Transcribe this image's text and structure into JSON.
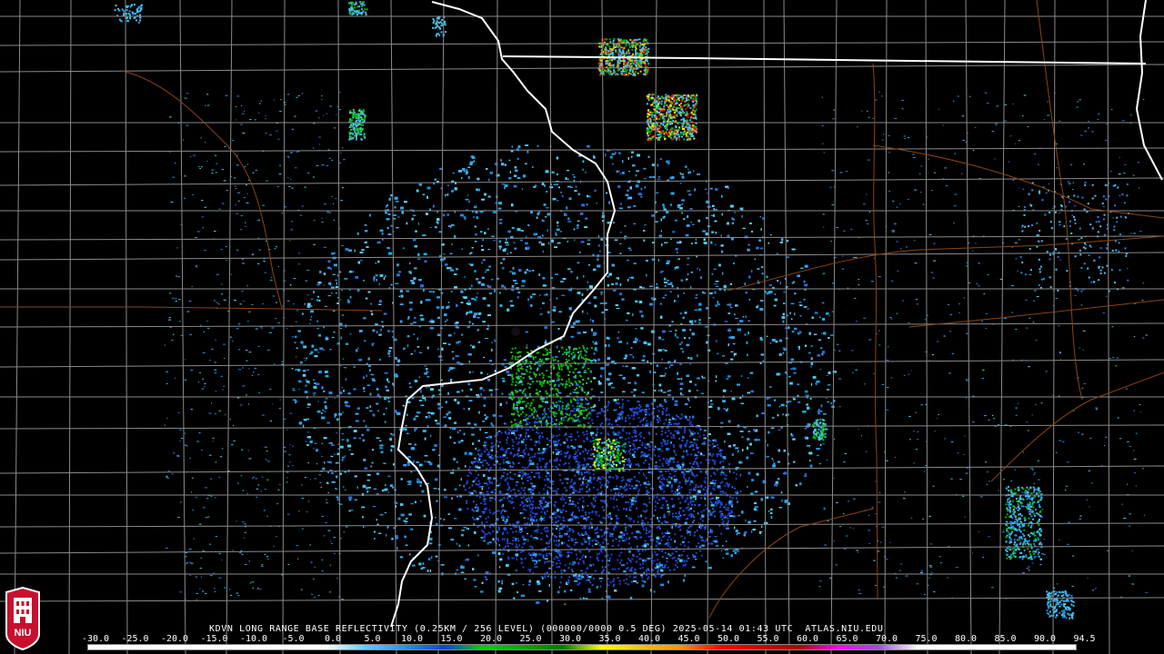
{
  "title": "KDVN LONG RANGE BASE REFLECTIVITY (0.25KM / 256 LEVEL) (000000/0000 0.5 DEG) 2025-05-14 01:43 UTC  ATLAS.NIU.EDU",
  "logo": {
    "text": "NIU",
    "icon": "university-seal-icon",
    "color": "#c8102e"
  },
  "colors": {
    "background": "#000000",
    "county_lines": "#8a8a8a",
    "state_lines": "#ffffff",
    "roads": "#8b4513"
  },
  "scale": {
    "ticks": [
      "-30.0",
      "-25.0",
      "-20.0",
      "-15.0",
      "-10.0",
      "-5.0",
      "0.0",
      "5.0",
      "10.0",
      "15.0",
      "20.0",
      "25.0",
      "30.0",
      "35.0",
      "40.0",
      "45.0",
      "50.0",
      "55.0",
      "60.0",
      "65.0",
      "70.0",
      "75.0",
      "80.0",
      "85.0",
      "90.0",
      "94.5"
    ],
    "colors": [
      "#ffffff",
      "#ffffff",
      "#ffffff",
      "#ffffff",
      "#ffffff",
      "#ffffff",
      "#ffffff",
      "#66ccff",
      "#2f8fe8",
      "#1a3fd6",
      "#00d200",
      "#00a800",
      "#007800",
      "#ffff00",
      "#e8c800",
      "#ff9000",
      "#ff0000",
      "#d40000",
      "#b00000",
      "#ff00ff",
      "#9a55c8",
      "#ffffff",
      "#ffffff",
      "#ffffff",
      "#ffffff"
    ]
  }
}
